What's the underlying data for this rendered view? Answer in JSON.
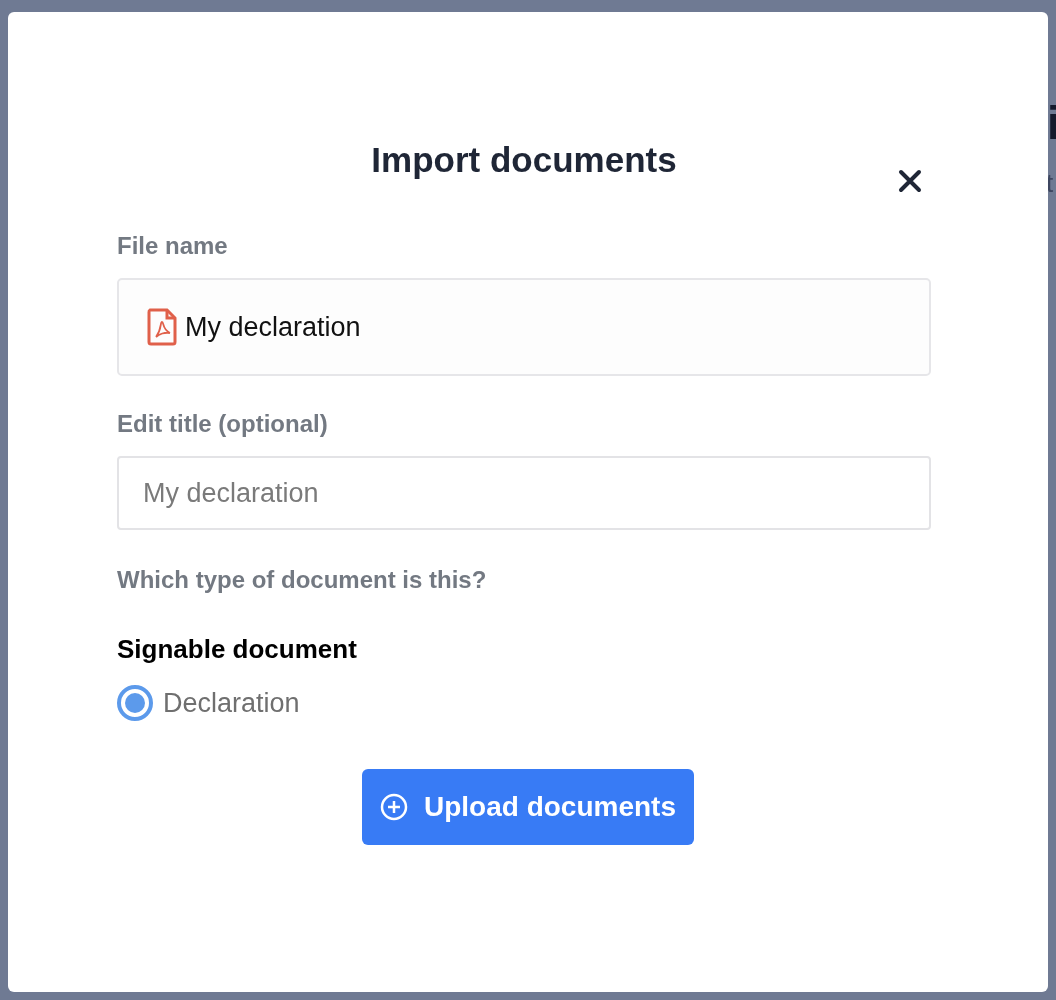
{
  "background": {
    "heading": "i",
    "subtext": "t"
  },
  "dialog": {
    "title": "Import documents",
    "file_name": {
      "label": "File name",
      "value": "My declaration"
    },
    "edit_title": {
      "label": "Edit title (optional)",
      "placeholder": "My declaration"
    },
    "type_question": "Which type of document is this?",
    "group_title": "Signable document",
    "options": [
      {
        "label": "Declaration",
        "selected": true
      }
    ],
    "submit": "Upload documents"
  }
}
